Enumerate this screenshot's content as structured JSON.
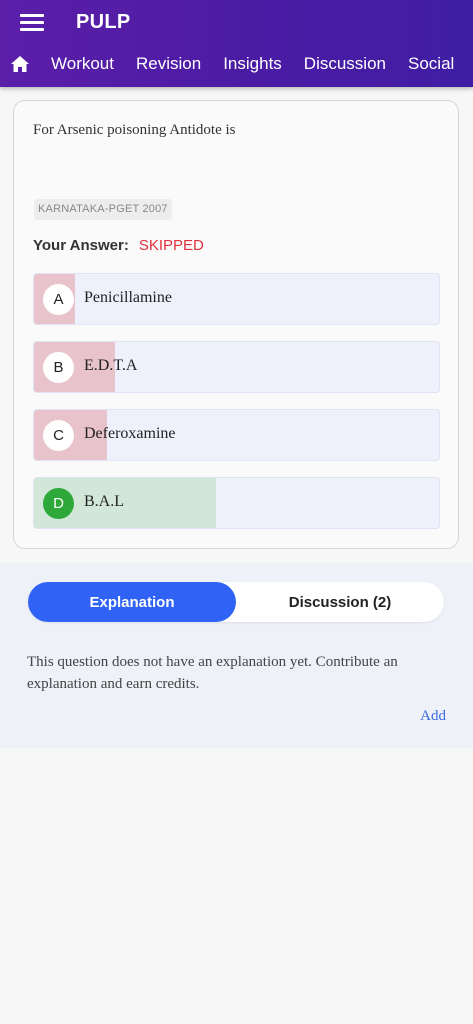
{
  "app": {
    "title": "PULP"
  },
  "nav": {
    "home_icon": "home-icon",
    "tabs": [
      "Workout",
      "Revision",
      "Insights",
      "Discussion",
      "Social"
    ]
  },
  "question": {
    "text": "For Arsenic poisoning Antidote is",
    "tag": "KARNATAKA-PGET 2007",
    "answer_label": "Your Answer:",
    "answer_value": "SKIPPED",
    "options": [
      {
        "letter": "A",
        "text": "Penicillamine",
        "response_fraction": 0.1,
        "correct": false
      },
      {
        "letter": "B",
        "text": "E.D.T.A",
        "response_fraction": 0.2,
        "correct": false
      },
      {
        "letter": "C",
        "text": "Deferoxamine",
        "response_fraction": 0.18,
        "correct": false
      },
      {
        "letter": "D",
        "text": "B.A.L",
        "response_fraction": 0.45,
        "correct": true
      }
    ]
  },
  "tabs_panel": {
    "explanation_label": "Explanation",
    "discussion_label": "Discussion (2)"
  },
  "explanation": {
    "text": "This question does not have an explanation yet. Contribute an explanation and earn credits.",
    "add_label": "Add"
  },
  "colors": {
    "header_purple": "#4b1ba4",
    "wrong_fill": "#e8c3cb",
    "correct_fill": "#d2e7d8",
    "correct_badge": "#2fa83a",
    "skipped_red": "#e0313d",
    "accent_blue": "#3063f5"
  }
}
